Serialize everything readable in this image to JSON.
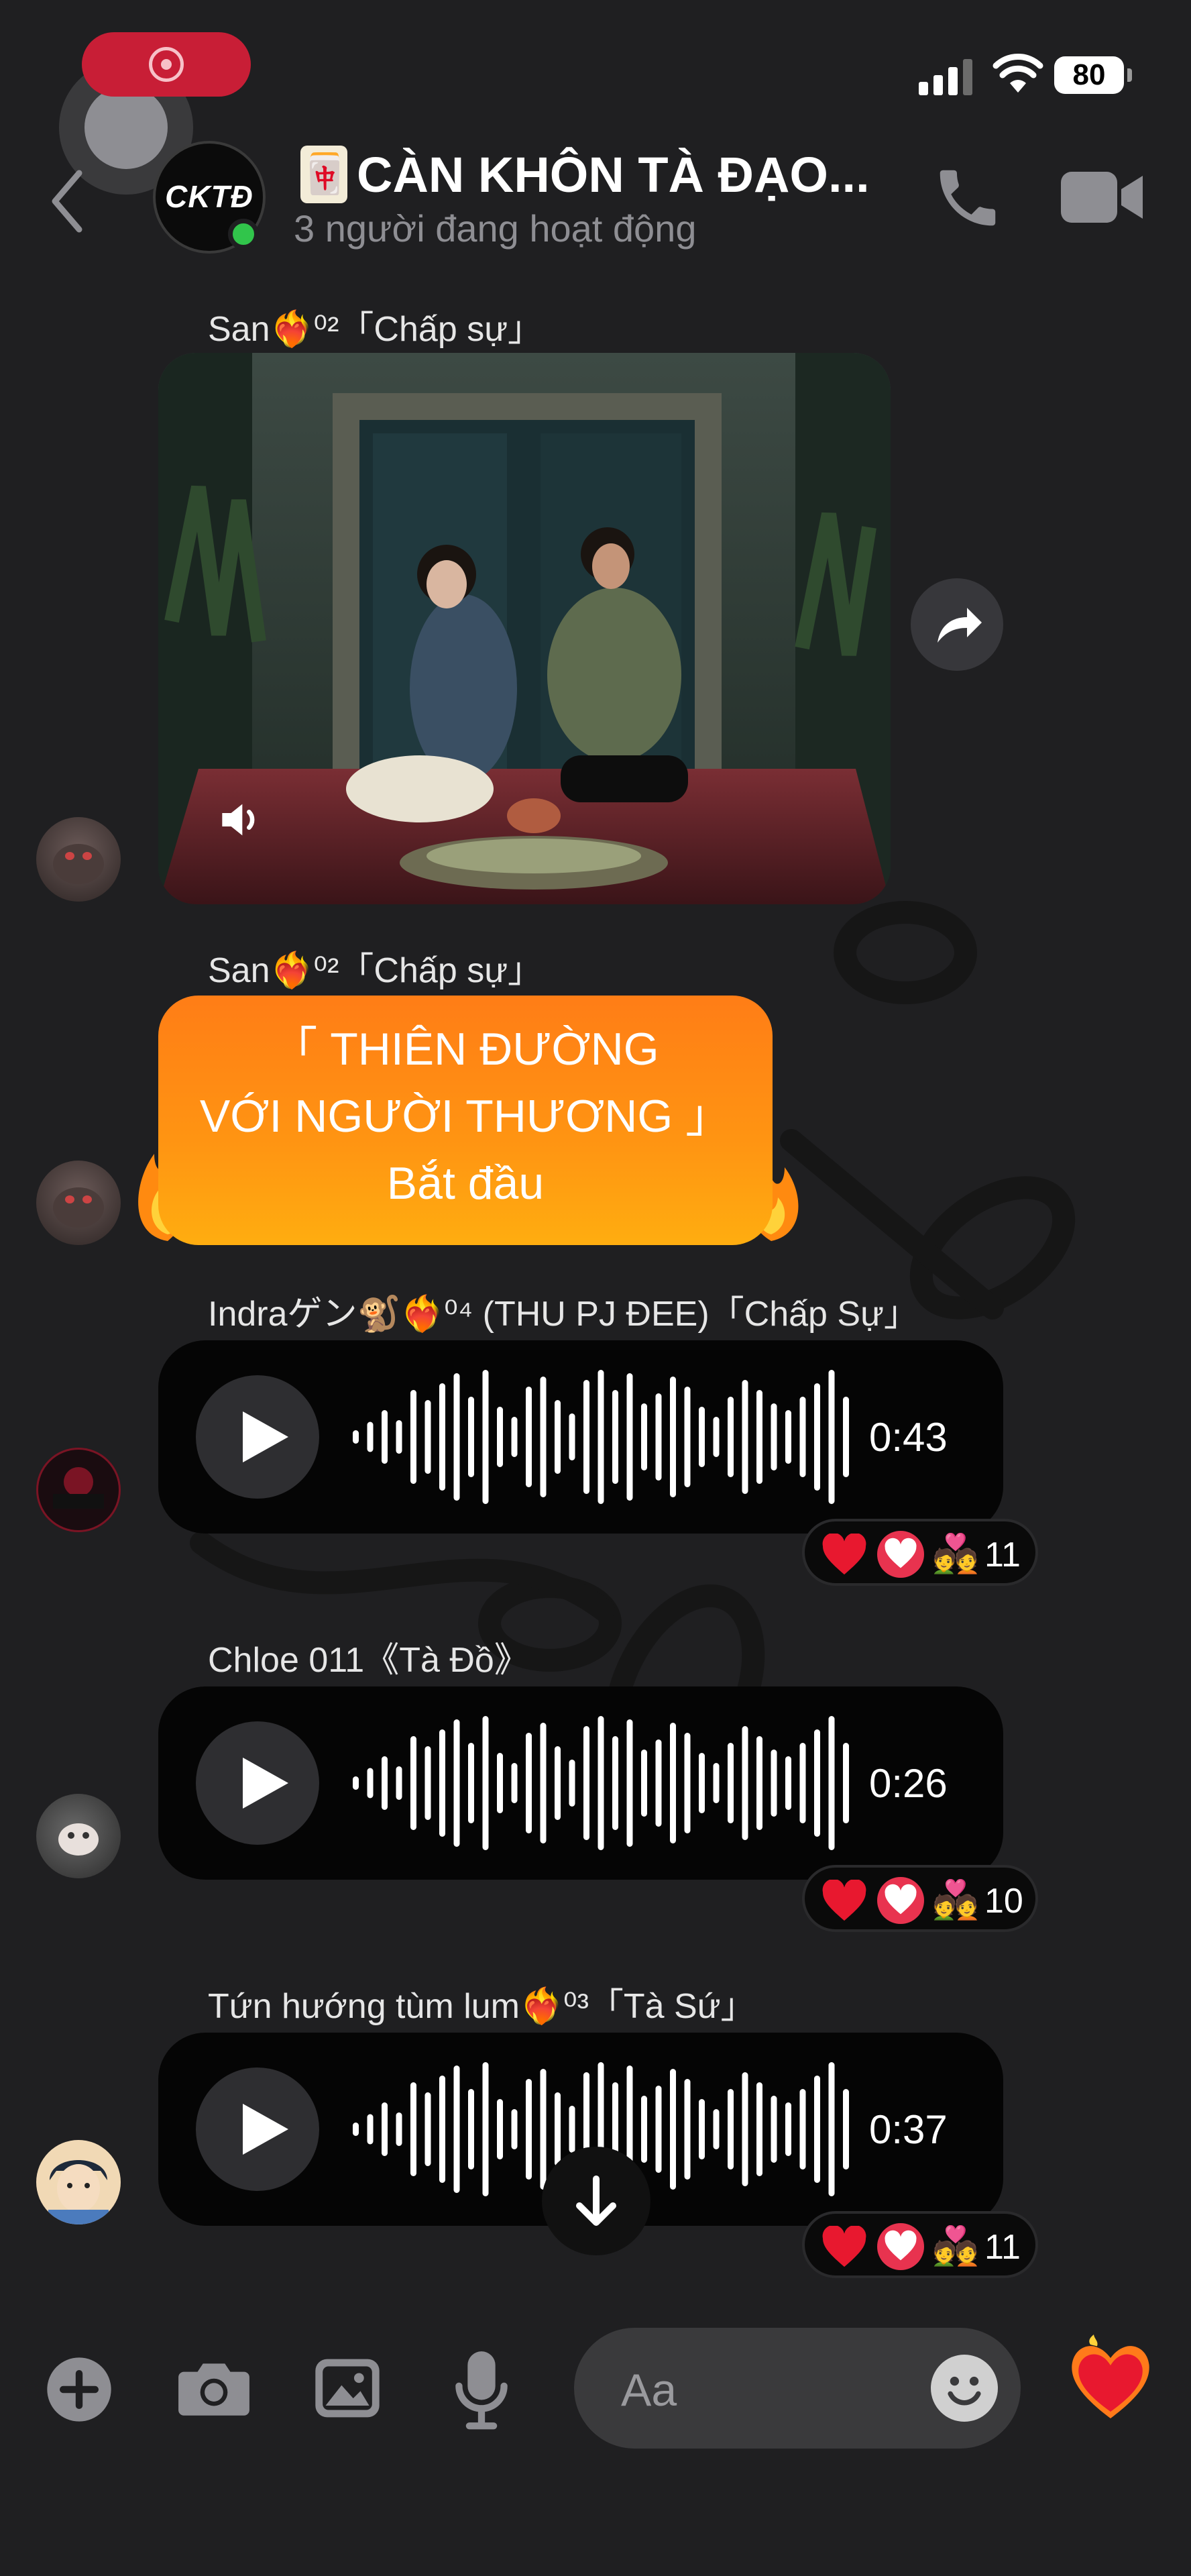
{
  "status_bar": {
    "battery": "80"
  },
  "header": {
    "group_avatar_text": "CKTĐ",
    "title_emoji": "🀄",
    "title": "CÀN KHÔN TÀ ĐẠO...",
    "subtitle": "3 người đang hoạt động",
    "icons": [
      "back-icon",
      "call-icon",
      "video-call-icon"
    ]
  },
  "messages": [
    {
      "type": "video",
      "sender": "San❤️‍🔥⁰²「Chấp sự」"
    },
    {
      "type": "text",
      "sender": "San❤️‍🔥⁰²「Chấp sự」",
      "lines": [
        "「     THIÊN ĐƯỜNG",
        "VỚI NGƯỜI THƯƠNG 」",
        "Bắt đầu"
      ]
    },
    {
      "type": "voice",
      "sender": "Indraゲン🐒❤️‍🔥⁰⁴ (THU PJ ĐEE)「Chấp Sự」",
      "duration": "0:43",
      "reaction_count": "11"
    },
    {
      "type": "voice",
      "sender": "Chloe 011《Tà Đồ》",
      "duration": "0:26",
      "reaction_count": "10"
    },
    {
      "type": "voice",
      "sender": "Tứn hướng tùm lum❤️‍🔥⁰³「Tà Sứ」",
      "duration": "0:37",
      "reaction_count": "11"
    }
  ],
  "composer": {
    "placeholder": "Aa",
    "icons": [
      "plus-icon",
      "camera-icon",
      "gallery-icon",
      "microphone-icon",
      "emoji-icon",
      "heart-icon"
    ]
  },
  "colors": {
    "background": "#1f1f21",
    "orange_bubble": "#ff8a14",
    "online": "#31c54b",
    "record": "#c81e36"
  }
}
